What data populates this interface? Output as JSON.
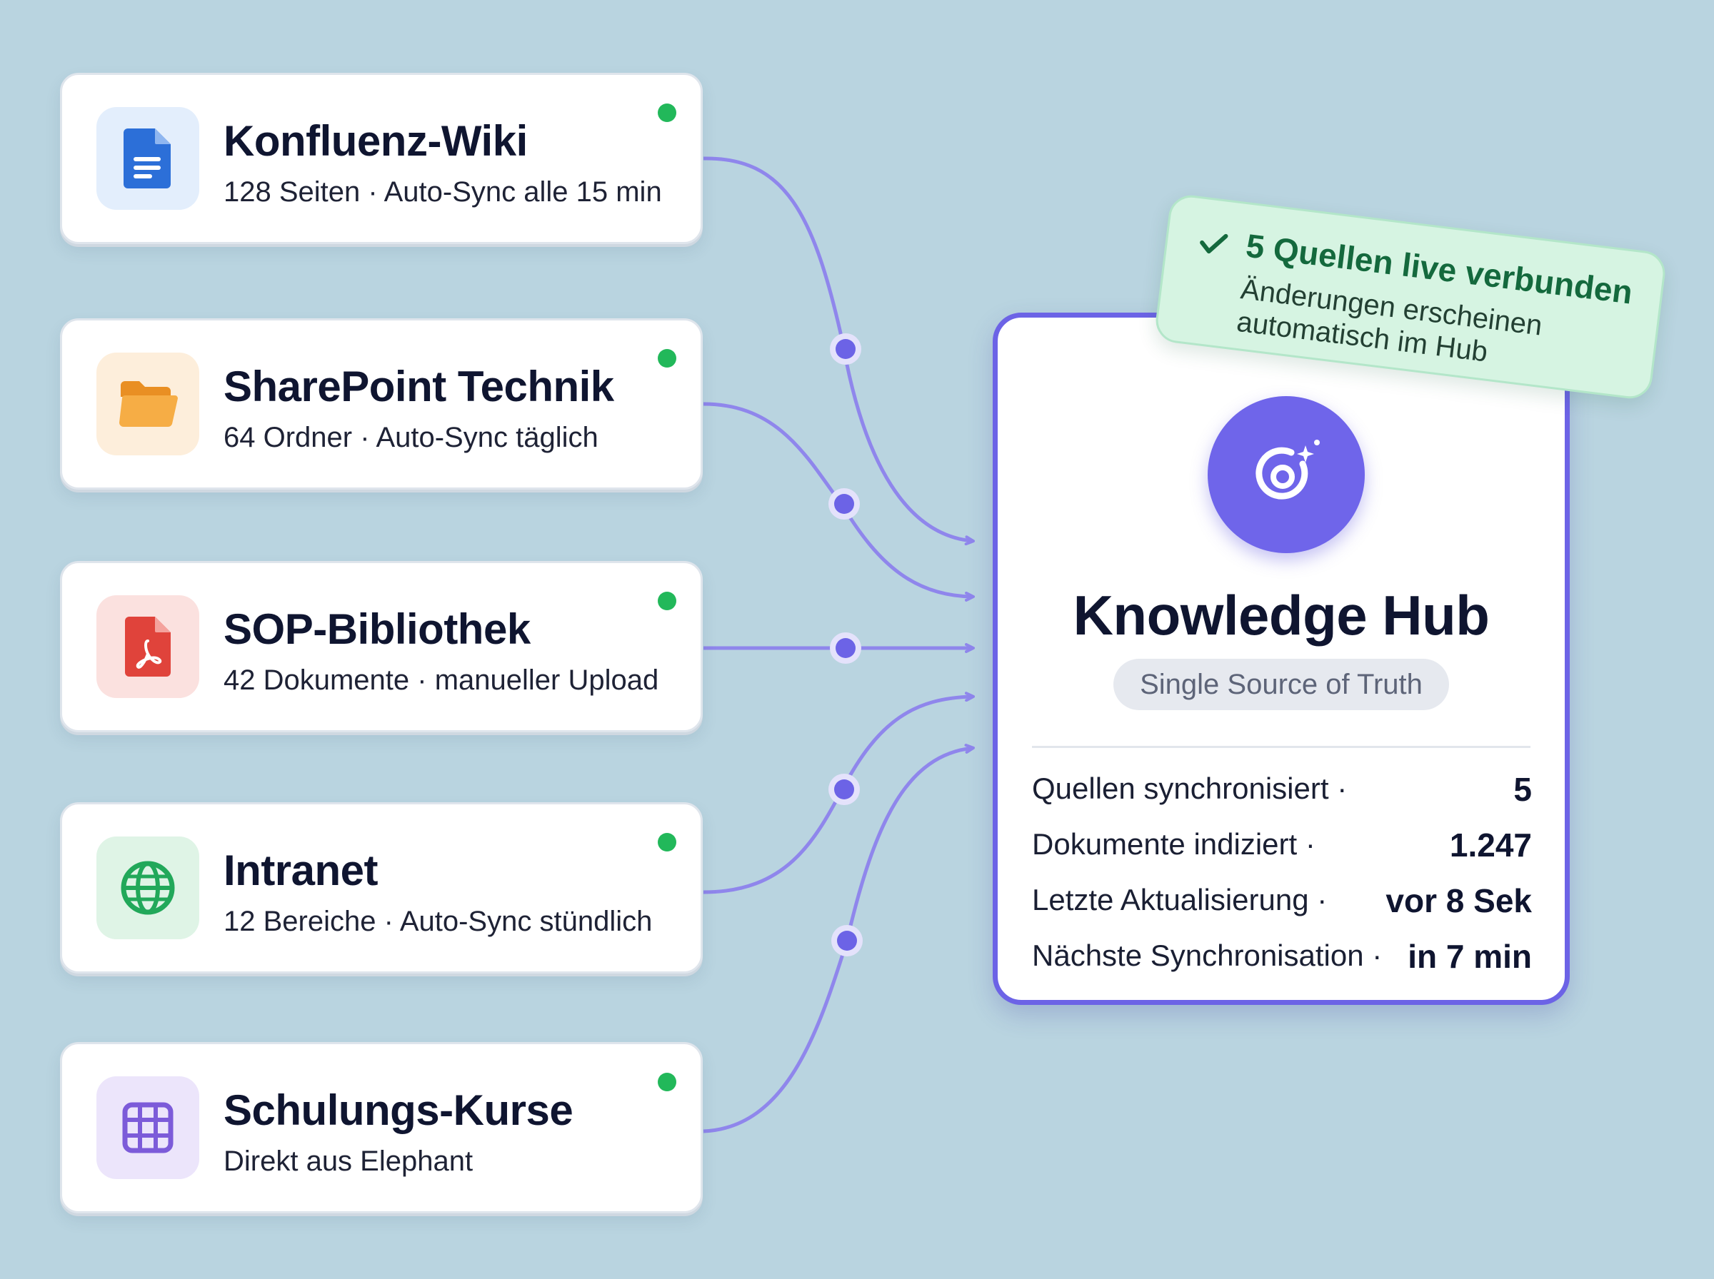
{
  "sources": [
    {
      "title": "Konfluenz-Wiki",
      "meta": "128 Seiten · Auto-Sync alle 15 min",
      "icon": "document-icon",
      "color": "#2c6fd8",
      "bg": "#e3eefc",
      "status": "online"
    },
    {
      "title": "SharePoint Technik",
      "meta": "64 Ordner · Auto-Sync täglich",
      "icon": "folder-icon",
      "color": "#f2a23a",
      "bg": "#fdeedb",
      "status": "online"
    },
    {
      "title": "SOP-Bibliothek",
      "meta": "42 Dokumente · manueller Upload",
      "icon": "pdf-icon",
      "color": "#e0433b",
      "bg": "#fbe1df",
      "status": "online"
    },
    {
      "title": "Intranet",
      "meta": "12 Bereiche · Auto-Sync stündlich",
      "icon": "globe-icon",
      "color": "#22a85a",
      "bg": "#dff4e6",
      "status": "online"
    },
    {
      "title": "Schulungs-Kurse",
      "meta": "Direkt aus Elephant",
      "icon": "grid-icon",
      "color": "#7c5bd9",
      "bg": "#ece5fb",
      "status": "online"
    }
  ],
  "hub": {
    "title": "Knowledge Hub",
    "subtitle": "Single Source of Truth",
    "icon": "orbit-sparkle-icon",
    "stats": [
      {
        "label": "Quellen synchronisiert ·",
        "value": "5"
      },
      {
        "label": "Dokumente indiziert ·",
        "value": "1.247"
      },
      {
        "label": "Letzte Aktualisierung ·",
        "value": "vor 8 Sek"
      },
      {
        "label": "Nächste Synchronisation ·",
        "value": "in 7 min"
      }
    ]
  },
  "banner": {
    "title": "5 Quellen live verbunden",
    "text": "Änderungen erscheinen automatisch im Hub",
    "icon": "check-icon"
  },
  "colors": {
    "background": "#b9d4e0",
    "connector": "#8f86ec",
    "connector_node": "#6c63e6",
    "hub_border": "#6c63e6",
    "status_online": "#22b85a",
    "banner_bg": "#d6f4e2",
    "banner_title": "#14693d"
  }
}
